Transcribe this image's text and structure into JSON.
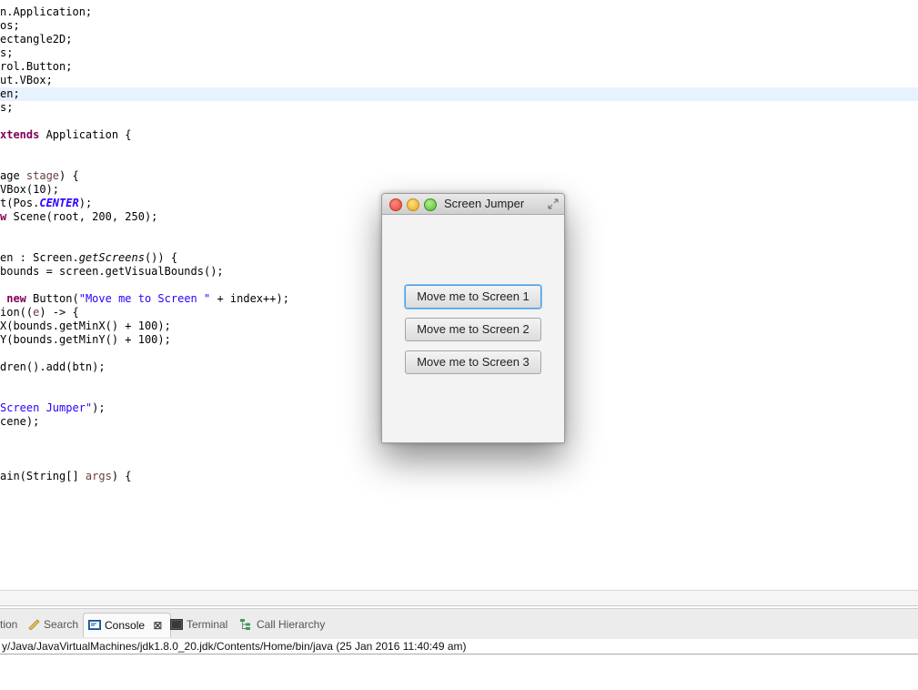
{
  "editor": {
    "lines": [
      {
        "segments": [
          {
            "t": "n.Application;"
          }
        ]
      },
      {
        "segments": [
          {
            "t": "os;"
          }
        ]
      },
      {
        "segments": [
          {
            "t": "ectangle2D;"
          }
        ]
      },
      {
        "segments": [
          {
            "t": "s;"
          }
        ]
      },
      {
        "segments": [
          {
            "t": "rol.Button;"
          }
        ]
      },
      {
        "segments": [
          {
            "t": "ut.VBox;"
          }
        ]
      },
      {
        "segments": [
          {
            "t": "en;"
          }
        ],
        "current": true
      },
      {
        "segments": [
          {
            "t": "s;"
          }
        ]
      },
      {
        "segments": [
          {
            "t": ""
          }
        ]
      },
      {
        "segments": [
          {
            "t": "xtends",
            "c": "kw"
          },
          {
            "t": " Application {"
          }
        ]
      },
      {
        "segments": [
          {
            "t": ""
          }
        ]
      },
      {
        "segments": [
          {
            "t": ""
          }
        ]
      },
      {
        "segments": [
          {
            "t": "age "
          },
          {
            "t": "stage",
            "c": "param"
          },
          {
            "t": ") {"
          }
        ]
      },
      {
        "segments": [
          {
            "t": "VBox(10);"
          }
        ]
      },
      {
        "segments": [
          {
            "t": "t(Pos."
          },
          {
            "t": "CENTER",
            "c": "stat"
          },
          {
            "t": ");"
          }
        ]
      },
      {
        "segments": [
          {
            "t": "w",
            "c": "kw"
          },
          {
            "t": " Scene(root, 200, 250);"
          }
        ]
      },
      {
        "segments": [
          {
            "t": ""
          }
        ]
      },
      {
        "segments": [
          {
            "t": ""
          }
        ]
      },
      {
        "segments": [
          {
            "t": "en : Screen."
          },
          {
            "t": "getScreens",
            "c": "stat-i"
          },
          {
            "t": "()) {"
          }
        ]
      },
      {
        "segments": [
          {
            "t": "bounds = screen.getVisualBounds();"
          }
        ]
      },
      {
        "segments": [
          {
            "t": ""
          }
        ]
      },
      {
        "segments": [
          {
            "t": " "
          },
          {
            "t": "new",
            "c": "kw"
          },
          {
            "t": " Button("
          },
          {
            "t": "\"Move me to Screen \"",
            "c": "str"
          },
          {
            "t": " + index++);"
          }
        ]
      },
      {
        "segments": [
          {
            "t": "ion(("
          },
          {
            "t": "e",
            "c": "param"
          },
          {
            "t": ") -> {"
          }
        ]
      },
      {
        "segments": [
          {
            "t": "X(bounds.getMinX() + 100);"
          }
        ]
      },
      {
        "segments": [
          {
            "t": "Y(bounds.getMinY() + 100);"
          }
        ]
      },
      {
        "segments": [
          {
            "t": ""
          }
        ]
      },
      {
        "segments": [
          {
            "t": "dren().add(btn);"
          }
        ]
      },
      {
        "segments": [
          {
            "t": ""
          }
        ]
      },
      {
        "segments": [
          {
            "t": ""
          }
        ]
      },
      {
        "segments": [
          {
            "t": "Screen Jumper\"",
            "c": "str"
          },
          {
            "t": ");"
          }
        ]
      },
      {
        "segments": [
          {
            "t": "cene);"
          }
        ]
      },
      {
        "segments": [
          {
            "t": ""
          }
        ]
      },
      {
        "segments": [
          {
            "t": ""
          }
        ]
      },
      {
        "segments": [
          {
            "t": ""
          }
        ]
      },
      {
        "segments": [
          {
            "t": "ain(String[] "
          },
          {
            "t": "args",
            "c": "param"
          },
          {
            "t": ") {"
          }
        ]
      }
    ]
  },
  "views": {
    "tabs": [
      {
        "label": "tion",
        "icon": "declaration-icon"
      },
      {
        "label": "Search",
        "icon": "search-flashlight-icon"
      },
      {
        "label": "Console",
        "icon": "console-icon",
        "active": true,
        "close": "⊠"
      },
      {
        "label": "Terminal",
        "icon": "terminal-icon"
      },
      {
        "label": "Call Hierarchy",
        "icon": "call-hierarchy-icon"
      }
    ],
    "console_path": "y/Java/JavaVirtualMachines/jdk1.8.0_20.jdk/Contents/Home/bin/java (25 Jan 2016 11:40:49 am)"
  },
  "window": {
    "title": "Screen Jumper",
    "buttons": [
      {
        "label": "Move me to Screen 1",
        "focused": true
      },
      {
        "label": "Move me to Screen 2"
      },
      {
        "label": "Move me to Screen 3"
      }
    ]
  }
}
